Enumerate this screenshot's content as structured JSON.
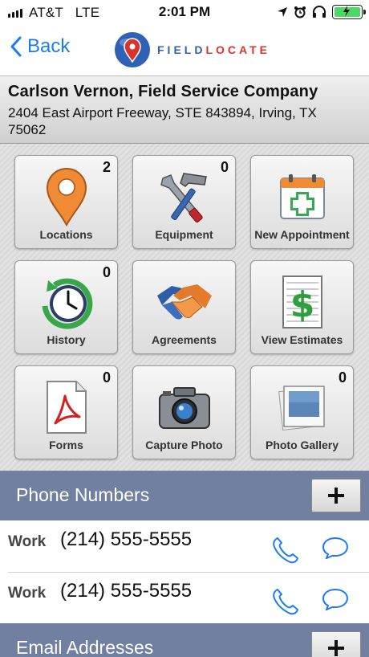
{
  "status_bar": {
    "carrier": "AT&T",
    "network": "LTE",
    "time": "2:01 PM",
    "battery_color": "#4cd964"
  },
  "nav": {
    "back_label": "Back",
    "logo_part1": "FIELD",
    "logo_part2": "LOCATE",
    "accent": "#1a7cf4"
  },
  "company": {
    "name": "Carlson Vernon, Field Service Company",
    "address": "2404 East Airport Freeway, STE 843894, Irving, TX 75062"
  },
  "tiles": [
    {
      "label": "Locations",
      "badge": "2",
      "icon": "map-pin-icon"
    },
    {
      "label": "Equipment",
      "badge": "0",
      "icon": "tools-icon"
    },
    {
      "label": "New Appointment",
      "badge": "",
      "icon": "calendar-add-icon"
    },
    {
      "label": "History",
      "badge": "0",
      "icon": "clock-history-icon"
    },
    {
      "label": "Agreements",
      "badge": "",
      "icon": "handshake-icon"
    },
    {
      "label": "View Estimates",
      "badge": "",
      "icon": "dollar-document-icon"
    },
    {
      "label": "Forms",
      "badge": "0",
      "icon": "pdf-document-icon"
    },
    {
      "label": "Capture Photo",
      "badge": "",
      "icon": "camera-icon"
    },
    {
      "label": "Photo Gallery",
      "badge": "0",
      "icon": "photo-stack-icon"
    }
  ],
  "phone_section": {
    "title": "Phone Numbers",
    "items": [
      {
        "type": "Work",
        "number": "(214) 555-5555"
      },
      {
        "type": "Work",
        "number": "(214) 555-5555"
      }
    ]
  },
  "email_section": {
    "title": "Email Addresses"
  },
  "colors": {
    "section_header": "#7180a0",
    "icon_blue": "#1a7cf4",
    "logo_blue": "#2f62b4",
    "logo_red": "#d9342b"
  }
}
